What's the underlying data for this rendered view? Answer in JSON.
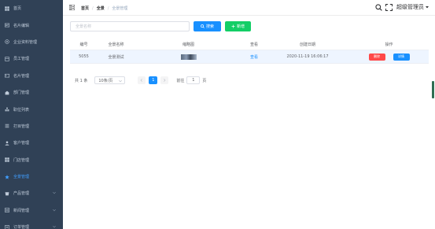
{
  "sidebar": {
    "items": [
      {
        "label": "首页",
        "icon": "dashboard-icon"
      },
      {
        "label": "名片编辑",
        "icon": "card-edit-icon"
      },
      {
        "label": "企业资料管理",
        "icon": "company-icon"
      },
      {
        "label": "员工管理",
        "icon": "staff-icon"
      },
      {
        "label": "名片管理",
        "icon": "card-icon"
      },
      {
        "label": "部门管理",
        "icon": "department-icon"
      },
      {
        "label": "职位列表",
        "icon": "position-icon"
      },
      {
        "label": "打目管理",
        "icon": "list-icon"
      },
      {
        "label": "客户管理",
        "icon": "customer-icon"
      },
      {
        "label": "门店管理",
        "icon": "store-icon"
      },
      {
        "label": "全景管理",
        "icon": "star-icon",
        "active": true
      },
      {
        "label": "产品管理",
        "icon": "product-icon",
        "submenu": true
      },
      {
        "label": "新闻管理",
        "icon": "news-icon",
        "submenu": true
      },
      {
        "label": "订单管理",
        "icon": "order-icon",
        "submenu": true
      }
    ],
    "background": "#304156",
    "active_color": "#409eff"
  },
  "header": {
    "breadcrumb": [
      "首页",
      "全景",
      "全景管理"
    ],
    "username": "超级管理员"
  },
  "toolbar": {
    "search_placeholder": "全景名称",
    "search_label": "搜索",
    "add_label": "新增"
  },
  "table": {
    "columns": [
      "编号",
      "全景名称",
      "缩略图",
      "查看",
      "创建日期",
      "操作"
    ],
    "rows": [
      {
        "id": "5055",
        "name": "全景测试",
        "view": "查看",
        "created": "2020-11-19 16:06:17",
        "delete_label": "删除",
        "detail_label": "详情"
      }
    ]
  },
  "pagination": {
    "total_text": "共 1 条",
    "page_size": "10条/页",
    "current_page": "1",
    "goto_label": "前往",
    "goto_value": "1",
    "page_unit": "页"
  },
  "colors": {
    "primary": "#1890ff",
    "success": "#13ce66",
    "danger": "#ff4949"
  }
}
